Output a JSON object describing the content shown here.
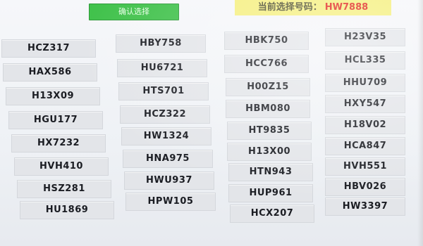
{
  "header": {
    "confirm_button": "确认选择",
    "current_label": "当前选择号码：",
    "current_code": "HW7888"
  },
  "plates": {
    "col1": [
      "HCZ317",
      "HAX586",
      "H13X09",
      "HGU177",
      "HX7232",
      "HVH410",
      "HSZ281",
      "HU1869"
    ],
    "col2": [
      "HBY758",
      "HU6721",
      "HTS701",
      "HCZ322",
      "HW1324",
      "HNA975",
      "HWU937",
      "HPW105"
    ],
    "col3": [
      "HBK750",
      "HCC766",
      "H00Z15",
      "HBM080",
      "HT9835",
      "H13X00",
      "HTN943",
      "HUP961",
      "HCX207"
    ],
    "col4": [
      "H23V35",
      "HCL335",
      "HHU709",
      "HXY547",
      "H18V02",
      "HCA847",
      "HVH551",
      "HBV026",
      "HW3397"
    ]
  }
}
